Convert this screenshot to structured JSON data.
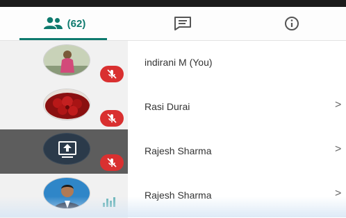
{
  "tabs": {
    "participants_count": "(62)"
  },
  "participants": [
    {
      "name": "indirani M (You)",
      "status": "muted"
    },
    {
      "name": "Rasi Durai",
      "status": "muted",
      "chevron": ">"
    },
    {
      "name": "Rajesh Sharma",
      "status": "muted",
      "chevron": ">"
    },
    {
      "name": "Rajesh Sharma",
      "status": "speaking",
      "chevron": ">"
    }
  ],
  "colors": {
    "accent": "#0e7a6e",
    "mute_badge": "#d93030",
    "highlight_row": "#5d5d5d"
  },
  "icons": {
    "participants_tab": "people-icon",
    "chat_tab": "chat-icon",
    "info_tab": "info-icon",
    "muted": "mic-off-icon",
    "speaking": "audio-level-icon",
    "screen_share": "presentation-icon"
  }
}
